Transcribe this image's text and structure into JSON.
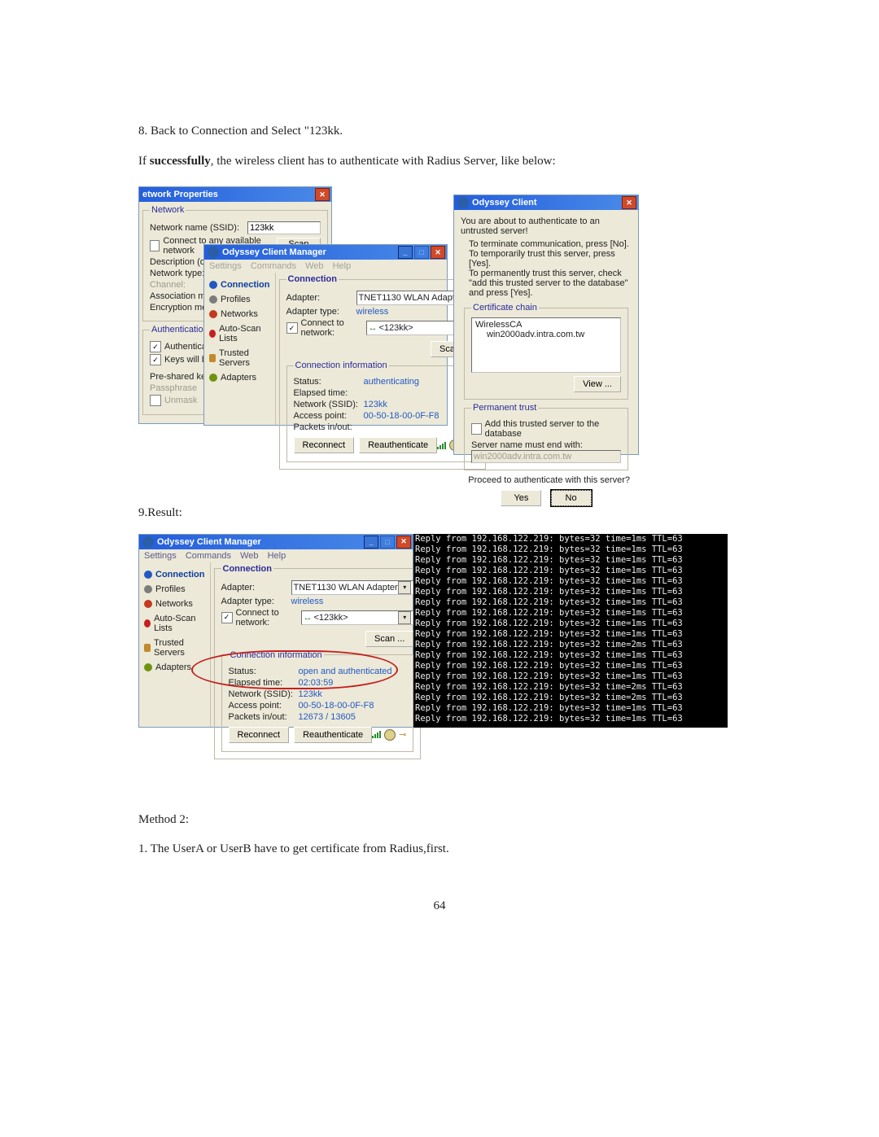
{
  "text": {
    "step8": "8. Back to Connection and Select \"123kk.",
    "ifSuccess_pre": "If ",
    "ifSuccess_bold": "successfully",
    "ifSuccess_post": ", the wireless client has to authenticate with Radius Server, like below:",
    "resultLabel": "9.Result:",
    "method2": "Method 2:",
    "method2step1": "1. The UserA or UserB have to get certificate from Radius,first.",
    "pageNum": "64"
  },
  "props": {
    "title": "etwork Properties",
    "legendNetwork": "Network",
    "ssidLabel": "Network name (SSID):",
    "ssidValue": "123kk",
    "anyNet": "Connect to any available network",
    "scan": "Scan ...",
    "descLabel": "Description (optional):",
    "typeLabel": "Network type:",
    "channel": "Channel:",
    "assocLabel": "Association mode:",
    "encLabel": "Encryption method:",
    "legendAuth": "Authentication",
    "authUsing": "Authenticate using p",
    "keysGen": "Keys will be genera",
    "psk": "Pre-shared key (WPA):",
    "passphrase": "Passphrase",
    "unmask": "Unmask"
  },
  "mgr": {
    "title": "Odyssey Client Manager",
    "menu": {
      "settings": "Settings",
      "commands": "Commands",
      "web": "Web",
      "help": "Help"
    },
    "side": [
      "Connection",
      "Profiles",
      "Networks",
      "Auto-Scan Lists",
      "Trusted Servers",
      "Adapters"
    ],
    "conn": {
      "legend": "Connection",
      "adapter": "Adapter:",
      "adapterVal": "TNET1130 WLAN Adapter",
      "adapterType": "Adapter type:",
      "adapterTypeVal": "wireless",
      "connectTo": "Connect to network:",
      "connectIcon": "↔",
      "connectVal": "<123kk>",
      "scan": "Scan ...",
      "info": "Connection information",
      "status": "Status:",
      "statusVal1": "authenticating",
      "statusVal2": "open and authenticated",
      "elapsed": "Elapsed time:",
      "elapsedVal": "02:03:59",
      "ssid": "Network (SSID):",
      "ssidVal": "123kk",
      "ap": "Access point:",
      "apVal": "00-50-18-00-0F-F8",
      "pkt": "Packets in/out:",
      "pktVal": "12673 / 13605",
      "reconnect": "Reconnect",
      "reauth": "Reauthenticate"
    }
  },
  "ody": {
    "title": "Odyssey Client",
    "msg1": "You are about to authenticate to an untrusted server!",
    "msg2": "To terminate communication, press [No].",
    "msg3": "To temporarily trust this server, press [Yes].",
    "msg4": "To permanently trust this server, check \"add this trusted server to the database\" and press [Yes].",
    "cert": "Certificate chain",
    "cert1": "WirelessCA",
    "cert2": "win2000adv.intra.com.tw",
    "view": "View ...",
    "perm": "Permanent trust",
    "addDb": "Add this trusted server to the database",
    "mustEnd": "Server name must end with:",
    "mustEndVal": "win2000adv.intra.com.tw",
    "proceed": "Proceed to authenticate with this server?",
    "yes": "Yes",
    "no": "No"
  },
  "ping": {
    "lines": [
      "Reply from 192.168.122.219: bytes=32 time=1ms TTL=63",
      "Reply from 192.168.122.219: bytes=32 time=1ms TTL=63",
      "Reply from 192.168.122.219: bytes=32 time=1ms TTL=63",
      "Reply from 192.168.122.219: bytes=32 time=1ms TTL=63",
      "Reply from 192.168.122.219: bytes=32 time=1ms TTL=63",
      "Reply from 192.168.122.219: bytes=32 time=1ms TTL=63",
      "Reply from 192.168.122.219: bytes=32 time=1ms TTL=63",
      "Reply from 192.168.122.219: bytes=32 time=1ms TTL=63",
      "Reply from 192.168.122.219: bytes=32 time=1ms TTL=63",
      "Reply from 192.168.122.219: bytes=32 time=1ms TTL=63",
      "Reply from 192.168.122.219: bytes=32 time=2ms TTL=63",
      "Reply from 192.168.122.219: bytes=32 time=1ms TTL=63",
      "Reply from 192.168.122.219: bytes=32 time=1ms TTL=63",
      "Reply from 192.168.122.219: bytes=32 time=1ms TTL=63",
      "Reply from 192.168.122.219: bytes=32 time=2ms TTL=63",
      "Reply from 192.168.122.219: bytes=32 time=2ms TTL=63",
      "Reply from 192.168.122.219: bytes=32 time=1ms TTL=63",
      "Reply from 192.168.122.219: bytes=32 time=1ms TTL=63"
    ]
  }
}
